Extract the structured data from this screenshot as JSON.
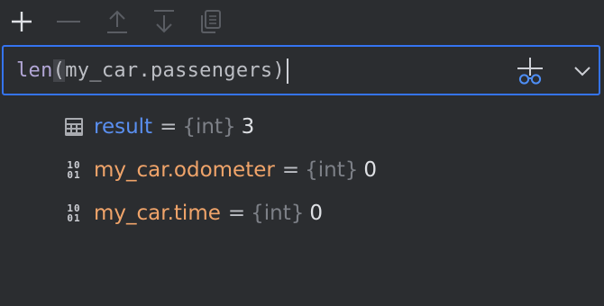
{
  "toolbar": {
    "buttons": [
      {
        "name": "add-watch-button",
        "icon": "plus-icon",
        "enabled": true
      },
      {
        "name": "remove-watch-button",
        "icon": "minus-icon",
        "enabled": false
      },
      {
        "name": "move-up-button",
        "icon": "arrow-up-icon",
        "enabled": false
      },
      {
        "name": "move-down-button",
        "icon": "arrow-down-icon",
        "enabled": false
      },
      {
        "name": "duplicate-watch-button",
        "icon": "copy-icon",
        "enabled": false
      }
    ]
  },
  "expression": {
    "function": "len",
    "paren_open": "(",
    "argument": "my_car.passengers",
    "paren_close": ")"
  },
  "variables": [
    {
      "icon": "calculator-icon",
      "name": "result",
      "eq": "=",
      "type": "{int}",
      "value": "3"
    },
    {
      "icon": "binary-icon",
      "name": "my_car.odometer",
      "eq": "=",
      "type": "{int}",
      "value": "0"
    },
    {
      "icon": "binary-icon",
      "name": "my_car.time",
      "eq": "=",
      "type": "{int}",
      "value": "0"
    }
  ],
  "binary_icon_text": {
    "line1": "10",
    "line2": "01"
  },
  "colors": {
    "background": "#2b2d30",
    "focus_border": "#3574f0",
    "result_name": "#5a8ff0",
    "field_name": "#f0a46a",
    "type_hint": "#7d8087",
    "value": "#dfe1e5"
  }
}
